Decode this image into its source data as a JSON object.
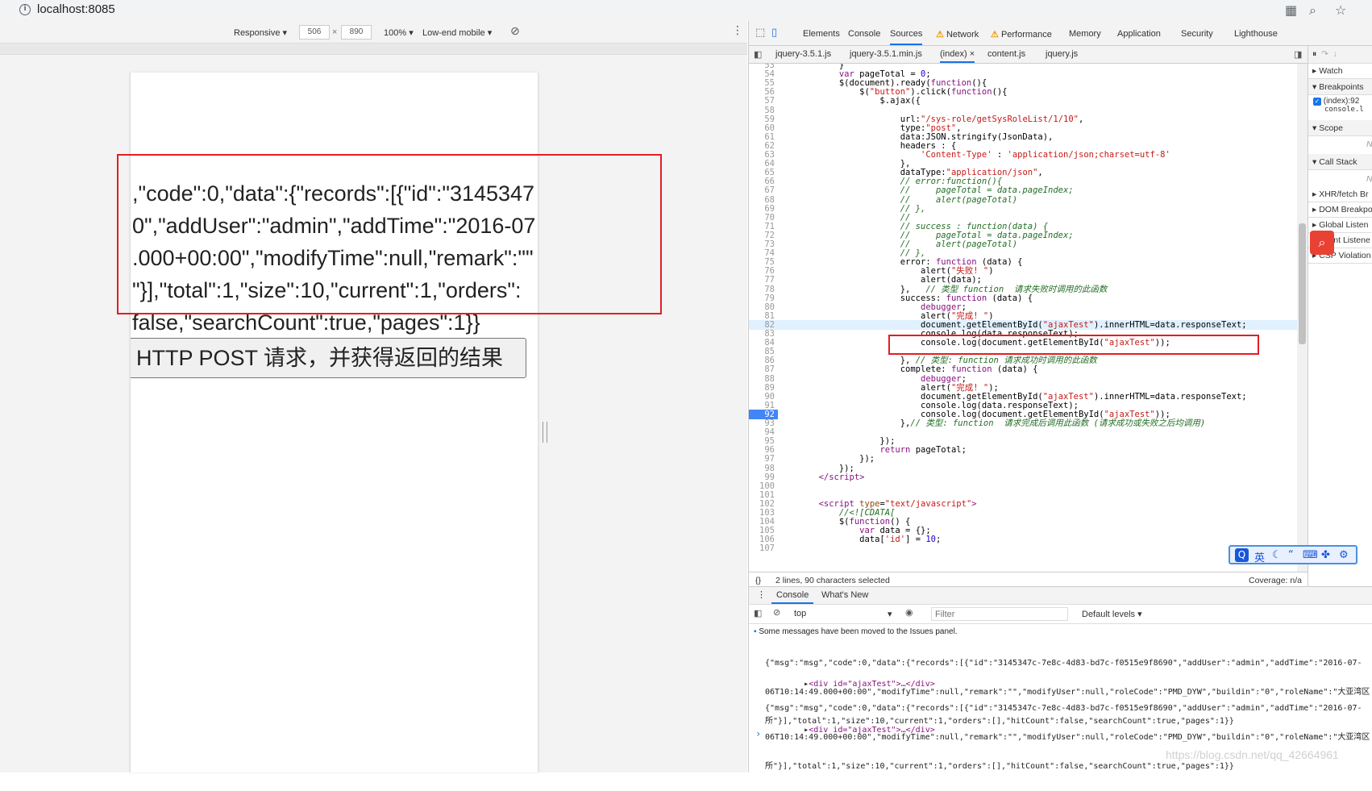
{
  "browser": {
    "url": "localhost:8085"
  },
  "device_toolbar": {
    "mode": "Responsive ▾",
    "width": "506",
    "times": "×",
    "height": "890",
    "zoom": "100% ▾",
    "throttle": "Low-end mobile ▾"
  },
  "viewport": {
    "lines": [
      ",\"code\":0,\"data\":{\"records\":[{\"id\":\"3145347",
      "0\",\"addUser\":\"admin\",\"addTime\":\"2016-07",
      ".000+00:00\",\"modifyTime\":null,\"remark\":\"\"",
      "\"}],\"total\":1,\"size\":10,\"current\":1,\"orders\":",
      "false,\"searchCount\":true,\"pages\":1}}"
    ],
    "button_label": "HTTP POST 请求，并获得返回的结果"
  },
  "devtools": {
    "tabs": [
      "Elements",
      "Console",
      "Sources",
      "Network",
      "Performance",
      "Memory",
      "Application",
      "Security",
      "Lighthouse"
    ],
    "active_tab": "Sources",
    "file_tabs": [
      "jquery-3.5.1.js",
      "jquery-3.5.1.min.js",
      "(index)",
      "content.js",
      "jquery.js"
    ],
    "active_file": "(index)",
    "status_selection": "2 lines, 90 characters selected",
    "status_coverage": "Coverage: n/a",
    "side_panels": [
      "Watch",
      "Breakpoints",
      "Scope",
      "Call Stack",
      "XHR/fetch Br",
      "DOM Breakpo",
      "Global Listen",
      "Event Listene",
      "CSP Violation"
    ],
    "breakpoint_item": "(index):92",
    "breakpoint_sub": "console.l",
    "side_na": "N"
  },
  "code_lines": [
    {
      "n": "53",
      "html": "            }"
    },
    {
      "n": "54",
      "html": "            <span class='k'>var</span> pageTotal = <span class='f'>0</span>;"
    },
    {
      "n": "55",
      "html": "            $(document).ready(<span class='k'>function</span>(){"
    },
    {
      "n": "56",
      "html": "                $(<span class='s'>\"button\"</span>).click(<span class='k'>function</span>(){"
    },
    {
      "n": "57",
      "html": "                    $.ajax({"
    },
    {
      "n": "58",
      "html": ""
    },
    {
      "n": "59",
      "html": "                        url:<span class='s'>\"/sys-role/getSysRoleList/1/10\"</span>,"
    },
    {
      "n": "60",
      "html": "                        type:<span class='s'>\"post\"</span>,"
    },
    {
      "n": "61",
      "html": "                        data:JSON.stringify(JsonData),"
    },
    {
      "n": "62",
      "html": "                        headers : {"
    },
    {
      "n": "63",
      "html": "                            <span class='s'>'Content-Type'</span> : <span class='s'>'application/json;charset=utf-8'</span>"
    },
    {
      "n": "64",
      "html": "                        },"
    },
    {
      "n": "65",
      "html": "                        dataType:<span class='s'>\"application/json\"</span>,"
    },
    {
      "n": "66",
      "html": "                        <span class='c'>// error:function(){</span>"
    },
    {
      "n": "67",
      "html": "                        <span class='c'>//     pageTotal = data.pageIndex;</span>"
    },
    {
      "n": "68",
      "html": "                        <span class='c'>//     alert(pageTotal)</span>"
    },
    {
      "n": "69",
      "html": "                        <span class='c'>// },</span>"
    },
    {
      "n": "70",
      "html": "                        <span class='c'>//</span>"
    },
    {
      "n": "71",
      "html": "                        <span class='c'>// success : function(data) {</span>"
    },
    {
      "n": "72",
      "html": "                        <span class='c'>//     pageTotal = data.pageIndex;</span>"
    },
    {
      "n": "73",
      "html": "                        <span class='c'>//     alert(pageTotal)</span>"
    },
    {
      "n": "74",
      "html": "                        <span class='c'>// },</span>"
    },
    {
      "n": "75",
      "html": "                        error: <span class='k'>function</span> (data) {"
    },
    {
      "n": "76",
      "html": "                            alert(<span class='s'>\"失败! \"</span>)"
    },
    {
      "n": "77",
      "html": "                            alert(data);"
    },
    {
      "n": "78",
      "html": "                        },   <span class='c'>// 类型 function  请求失败时调用的此函数</span>"
    },
    {
      "n": "79",
      "html": "                        success: <span class='k'>function</span> (data) {"
    },
    {
      "n": "80",
      "html": "                            <span class='k'>debugger</span>;"
    },
    {
      "n": "81",
      "html": "                            alert(<span class='s'>\"完成! \"</span>)"
    },
    {
      "n": "82",
      "html": "                            document.getElementById(<span class='s'>\"ajaxTest\"</span>).innerHTML=data.responseText;"
    },
    {
      "n": "83",
      "html": "                            console.log(data.responseText);"
    },
    {
      "n": "84",
      "html": "                            console.log(document.getElementById(<span class='s'>\"ajaxTest\"</span>));"
    },
    {
      "n": "85",
      "html": ""
    },
    {
      "n": "86",
      "html": "                        }, <span class='c'>// 类型: function 请求成功时调用的此函数</span>"
    },
    {
      "n": "87",
      "html": "                        complete: <span class='k'>function</span> (data) {"
    },
    {
      "n": "88",
      "html": "                            <span class='k'>debugger</span>;"
    },
    {
      "n": "89",
      "html": "                            alert(<span class='s'>\"完成! \"</span>);"
    },
    {
      "n": "90",
      "html": "                            document.getElementById(<span class='s'>\"ajaxTest\"</span>).innerHTML=data.responseText;"
    },
    {
      "n": "91",
      "html": "                            console.log(data.responseText);"
    },
    {
      "n": "92",
      "html": "                            console.log(document.getElementById(<span class='s'>\"ajaxTest\"</span>));"
    },
    {
      "n": "93",
      "html": "                        },<span class='c'>// 类型: function  请求完成后调用此函数 (请求成功或失败之后均调用)</span>"
    },
    {
      "n": "94",
      "html": ""
    },
    {
      "n": "95",
      "html": "                    });"
    },
    {
      "n": "96",
      "html": "                    <span class='k'>return</span> pageTotal;"
    },
    {
      "n": "97",
      "html": "                });"
    },
    {
      "n": "98",
      "html": "            });"
    },
    {
      "n": "99",
      "html": "        <span class='t'>&lt;/script&gt;</span>"
    },
    {
      "n": "100",
      "html": ""
    },
    {
      "n": "101",
      "html": ""
    },
    {
      "n": "102",
      "html": "        <span class='t'>&lt;script</span> <span class='a'>type</span>=<span class='s'>\"text/javascript\"</span><span class='t'>&gt;</span>"
    },
    {
      "n": "103",
      "html": "            <span class='c'>//&lt;![CDATA[</span>"
    },
    {
      "n": "104",
      "html": "            $(<span class='k'>function</span>() {"
    },
    {
      "n": "105",
      "html": "                <span class='k'>var</span> data = {};"
    },
    {
      "n": "106",
      "html": "                data[<span class='s'>'id'</span>] = <span class='f'>10</span>;"
    },
    {
      "n": "107",
      "html": ""
    }
  ],
  "console": {
    "tabs": [
      "Console",
      "What's New"
    ],
    "context": "top",
    "filter_placeholder": "Filter",
    "levels": "Default levels ▾",
    "info": "Some messages have been moved to the Issues panel.",
    "msg1": [
      "{\"msg\":\"msg\",\"code\":0,\"data\":{\"records\":[{\"id\":\"3145347c-7e8c-4d83-bd7c-f0515e9f8690\",\"addUser\":\"admin\",\"addTime\":\"2016-07-",
      "06T10:14:49.000+00:00\",\"modifyTime\":null,\"remark\":\"\",\"modifyUser\":null,\"roleCode\":\"PMD_DYW\",\"buildin\":\"0\",\"roleName\":\"大亚湾区务",
      "所\"}],\"total\":1,\"size\":10,\"current\":1,\"orders\":[],\"hitCount\":false,\"searchCount\":true,\"pages\":1}}"
    ],
    "div1": "<div id=\"ajaxTest\">…</div>",
    "msg2": [
      "{\"msg\":\"msg\",\"code\":0,\"data\":{\"records\":[{\"id\":\"3145347c-7e8c-4d83-bd7c-f0515e9f8690\",\"addUser\":\"admin\",\"addTime\":\"2016-07-",
      "06T10:14:49.000+00:00\",\"modifyTime\":null,\"remark\":\"\",\"modifyUser\":null,\"roleCode\":\"PMD_DYW\",\"buildin\":\"0\",\"roleName\":\"大亚湾区务",
      "所\"}],\"total\":1,\"size\":10,\"current\":1,\"orders\":[],\"hitCount\":false,\"searchCount\":true,\"pages\":1}}"
    ],
    "div2": "<div id=\"ajaxTest\">…</div>"
  },
  "ime": {
    "label": "英"
  },
  "watermark": "https://blog.csdn.net/qq_42664961"
}
